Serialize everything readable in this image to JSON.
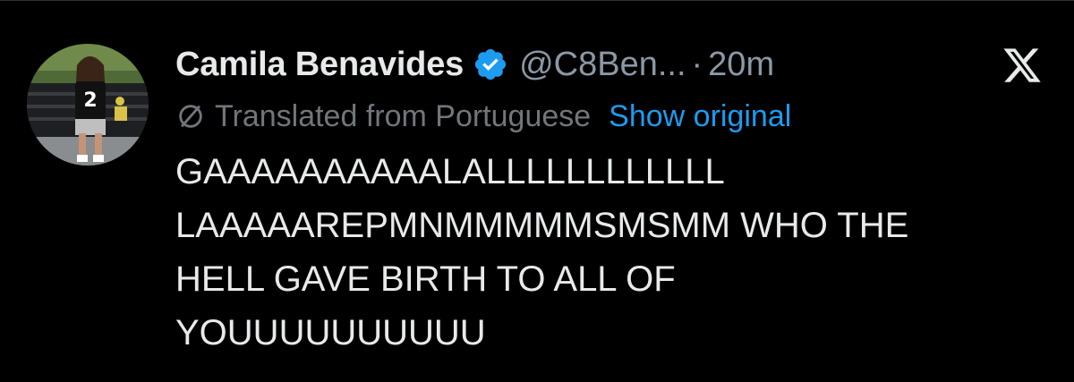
{
  "tweet": {
    "display_name": "Camila Benavides",
    "handle": "@C8Ben...",
    "separator": "·",
    "time": "20m",
    "translated_label": "Translated from Portuguese",
    "show_original_label": "Show original",
    "body_lines": [
      "GAAAAAAAAAALALLLLLLLLLLLL",
      "LAAAAAREPMNMMMMMSMSMM WHO THE",
      "HELL GAVE BIRTH TO ALL OF",
      "YOUUUUUUUUUU"
    ]
  },
  "icons": {
    "verified": "verified-badge-icon",
    "translate": "translate-icon",
    "logo": "x-logo-icon"
  },
  "colors": {
    "background": "#000000",
    "primary_text": "#e7e9ea",
    "secondary_text": "#8b98a5",
    "link": "#1d9bf0",
    "verified": "#1d9bf0"
  }
}
